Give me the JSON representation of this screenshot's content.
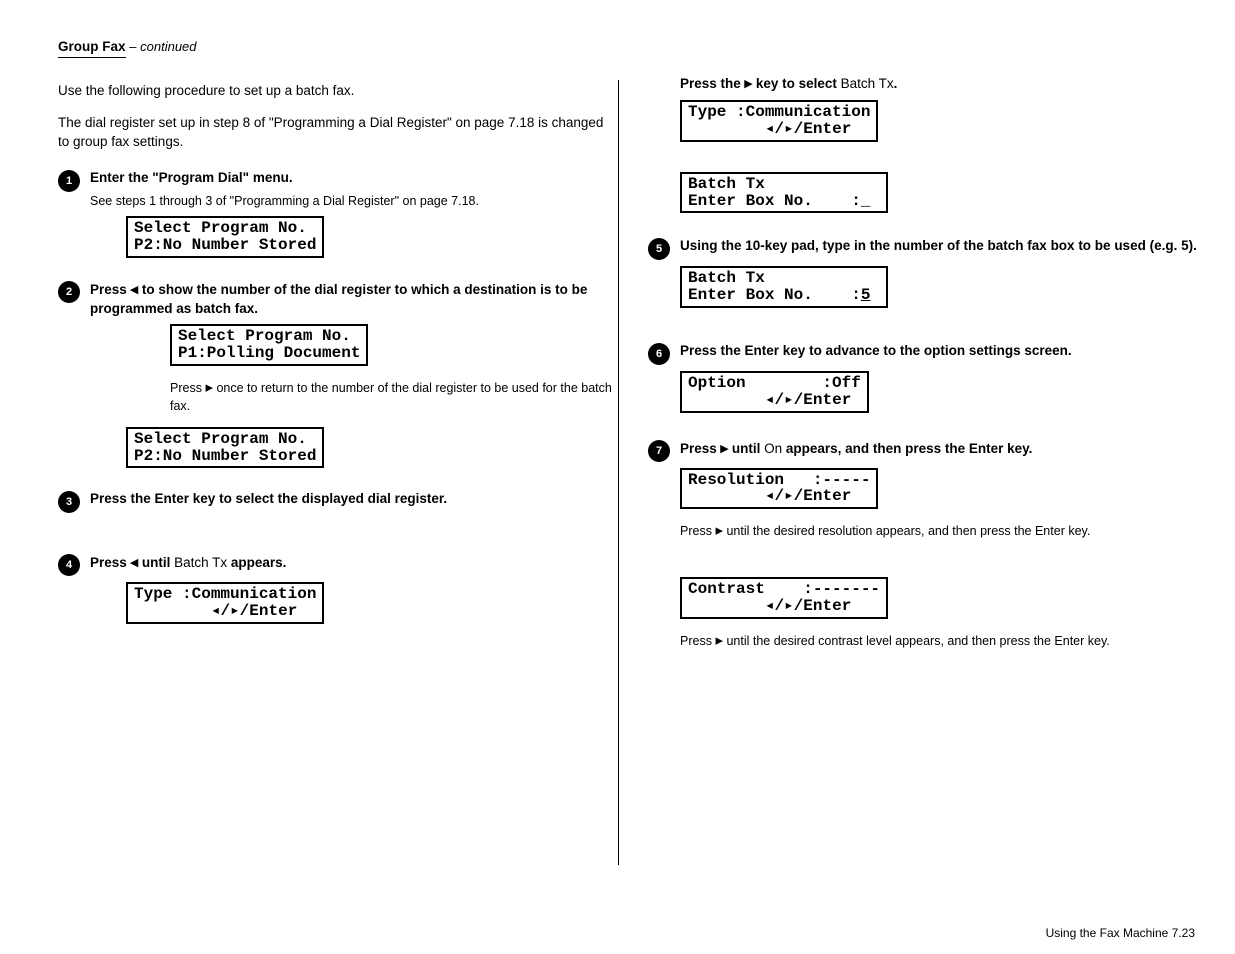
{
  "left": {
    "title": "Group Fax",
    "continued": "– continued",
    "intro1": "Use the following procedure to set up a batch fax.",
    "intro2_a": "The dial register set up in step 8 of \"Programming a Dial Register\" on page ",
    "intro2_page": "7.18",
    "intro2_b": " is changed to group fax settings.",
    "step1": {
      "title": "Enter the \"Program Dial\" menu.",
      "a": "See steps 1 through 3 of \"Programming a Dial Register\" on page ",
      "page": "7.18",
      "b": ".",
      "lcd1_l1": "Select Program No.",
      "lcd1_l2": "P2:No Number Stored"
    },
    "step2": {
      "title_a": "Press ",
      "title_b": " to show the number of the dial register to which a destination is to be programmed as batch fax.",
      "lcd_l1": "Select Program No.",
      "lcd_l2": "P1:Polling Document",
      "extra_a": "Press ",
      "extra_b": " once to return to the number of the dial register to be used for the batch fax.",
      "lcd2_l1": "Select Program No.",
      "lcd2_l2": "P2:No Number Stored"
    },
    "step3": {
      "title": "Press the Enter key to select the displayed dial register."
    },
    "step4": {
      "title_a": "Press ",
      "title_b": " until ",
      "title_c": " appears.",
      "setting": "Batch Tx",
      "lcd_l1": "Type :Communication",
      "lcd_l2": "        ◂/▸/Enter"
    },
    "right_continue_a": "Press the ",
    "right_continue_b": " key to select ",
    "right_continue_c": ".",
    "right_continue_setting": "Batch Tx",
    "rlc1_l1": "Type :Communication",
    "rlc1_l2": "        ◂/▸/Enter",
    "rlc2_l1": "Batch Tx            ",
    "rlc2_l2": "Enter Box No.    :_",
    "step5": {
      "title": "Using the 10-key pad, type in the number of the batch fax box to be used (e.g. 5).",
      "lcd_l1": "Batch Tx            ",
      "lcd_l2": "Enter Box No.    :",
      "val": "5"
    },
    "step6": {
      "title": "Press the Enter key to advance to the option settings screen.",
      "lcd_l1": "Option        :Off",
      "lcd_l2": "        ◂/▸/Enter"
    },
    "step7": {
      "title_a": "Press ",
      "title_b": " until ",
      "title_c": " appears, and then press the Enter key.",
      "setting": "On",
      "lcd_l1": "Resolution   :-----",
      "lcd_l2": "        ◂/▸/Enter",
      "extra_a": "Press ",
      "extra_b": " until the desired resolution appears, and then press the Enter key."
    },
    "step_res": {
      "lcd_l1": "Contrast    :-------",
      "lcd_l2": "        ◂/▸/Enter",
      "extra_a": "Press ",
      "extra_b": " until the desired contrast level appears, and then press the Enter key."
    },
    "footer": "Using the Fax Machine 7.23"
  }
}
